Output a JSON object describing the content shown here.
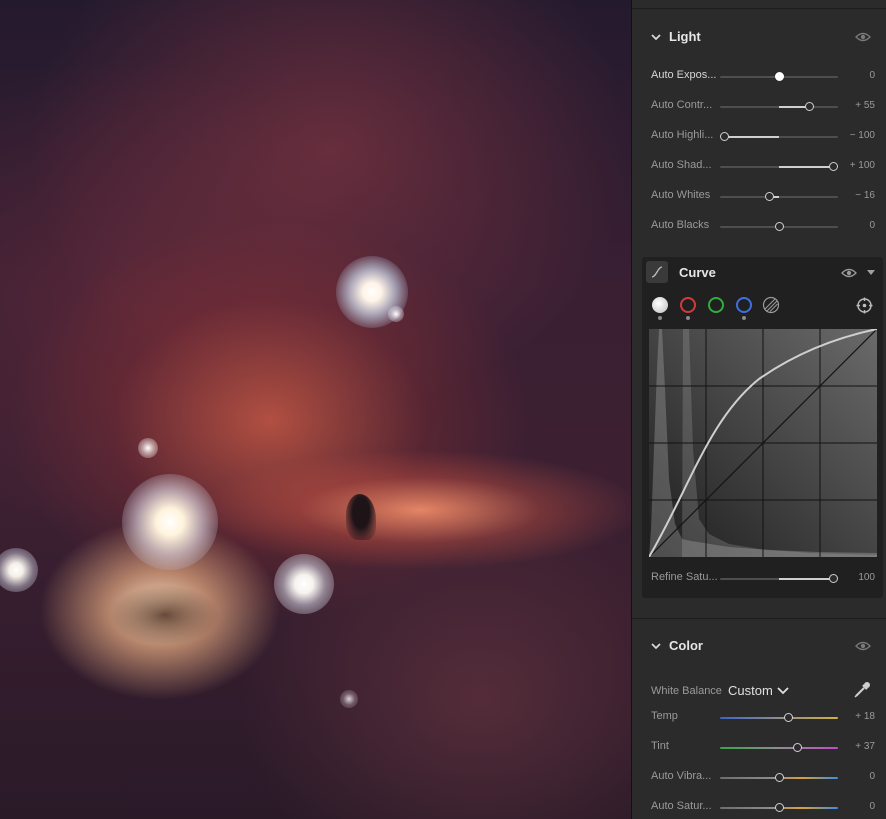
{
  "light": {
    "title": "Light",
    "sliders": [
      {
        "label": "Auto Expos...",
        "value": "0",
        "position": 0.5
      },
      {
        "label": "Auto Contr...",
        "value": "+ 55",
        "position": 0.76
      },
      {
        "label": "Auto Highli...",
        "value": "− 100",
        "position": 0.04
      },
      {
        "label": "Auto Shad...",
        "value": "+ 100",
        "position": 0.96
      },
      {
        "label": "Auto Whites",
        "value": "− 16",
        "position": 0.42
      },
      {
        "label": "Auto Blacks",
        "value": "0",
        "position": 0.5
      }
    ]
  },
  "curve": {
    "title": "Curve",
    "channels": [
      "point",
      "red",
      "green",
      "blue",
      "luminance"
    ],
    "refine_saturation": {
      "label": "Refine Satu...",
      "value": "100",
      "position": 0.96
    }
  },
  "color": {
    "title": "Color",
    "white_balance_label": "White Balance",
    "white_balance_value": "Custom",
    "sliders": [
      {
        "label": "Temp",
        "value": "+ 18",
        "position": 0.58
      },
      {
        "label": "Tint",
        "value": "+ 37",
        "position": 0.66
      },
      {
        "label": "Auto Vibra...",
        "value": "0",
        "position": 0.5
      },
      {
        "label": "Auto Satur...",
        "value": "0",
        "position": 0.5
      }
    ]
  },
  "colors": {
    "panel_bg": "#2b2b2b",
    "accent_red": "#d23b3b",
    "accent_green": "#2fae3e",
    "accent_blue": "#3f6fe0"
  }
}
